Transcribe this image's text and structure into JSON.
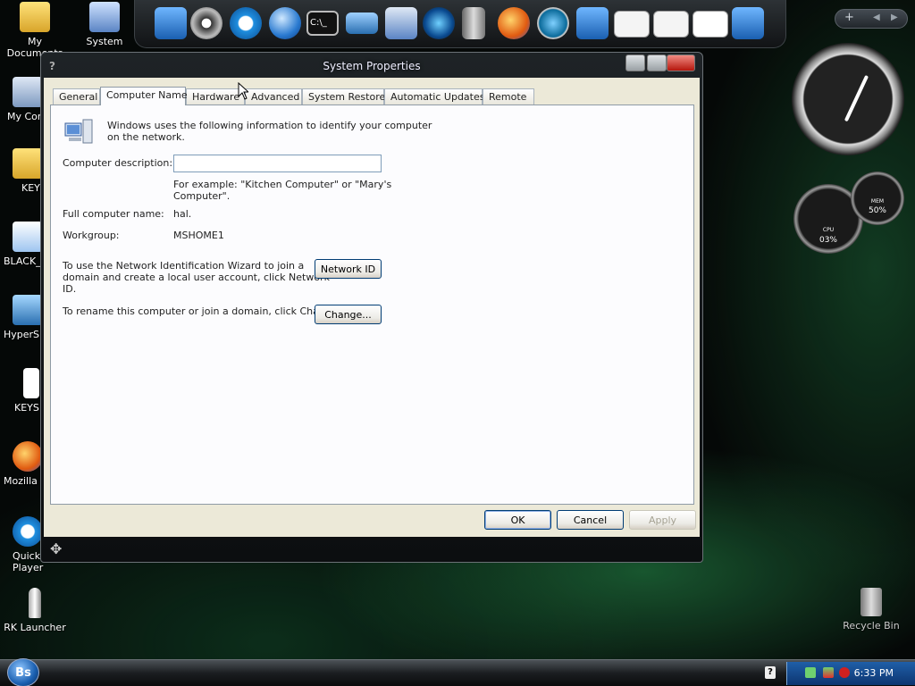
{
  "desktop": {
    "icons": [
      {
        "label": "My Documents"
      },
      {
        "label": "System"
      },
      {
        "label": "My Com"
      },
      {
        "label": "KEY"
      },
      {
        "label": "BLACK_"
      },
      {
        "label": "HyperSn"
      },
      {
        "label": "KEYS"
      },
      {
        "label": "Mozilla F"
      },
      {
        "label": "Quick\nPlayer"
      },
      {
        "label": "RK Launcher"
      },
      {
        "label": "Recycle Bin"
      }
    ],
    "dock_nav": {
      "add": "+",
      "prev": "◀",
      "next": "▶"
    }
  },
  "gadgets": {
    "cpu_label": "CPU",
    "cpu_value": "03%",
    "mem_label": "MEM",
    "mem_value": "50%"
  },
  "window": {
    "title": "System Properties",
    "help_glyph": "?",
    "tabs": [
      {
        "label": "General",
        "active": false
      },
      {
        "label": "Computer Name",
        "active": true
      },
      {
        "label": "Hardware",
        "active": false
      },
      {
        "label": "Advanced",
        "active": false
      },
      {
        "label": "System Restore",
        "active": false
      },
      {
        "label": "Automatic Updates",
        "active": false
      },
      {
        "label": "Remote",
        "active": false
      }
    ],
    "panel": {
      "intro_line1": "Windows uses the following information to identify your computer",
      "intro_line2": "on the network.",
      "description_label": "Computer description:",
      "description_value": "",
      "example_line1": "For example: \"Kitchen Computer\" or \"Mary's",
      "example_line2": "Computer\".",
      "full_name_label": "Full computer name:",
      "full_name_value": "hal.",
      "workgroup_label": "Workgroup:",
      "workgroup_value": "MSHOME1",
      "wizard_line1": "To use the Network Identification Wizard to join a",
      "wizard_line2": "domain and create a local user account, click Network",
      "wizard_line3": "ID.",
      "network_id_button": "Network ID",
      "rename_text": "To rename this computer or join a domain, click Change.",
      "change_button": "Change..."
    },
    "buttons": {
      "ok": "OK",
      "cancel": "Cancel",
      "apply": "Apply"
    }
  },
  "taskbar": {
    "start_label": "Bs",
    "help_glyph": "?",
    "clock": "6:33 PM"
  }
}
